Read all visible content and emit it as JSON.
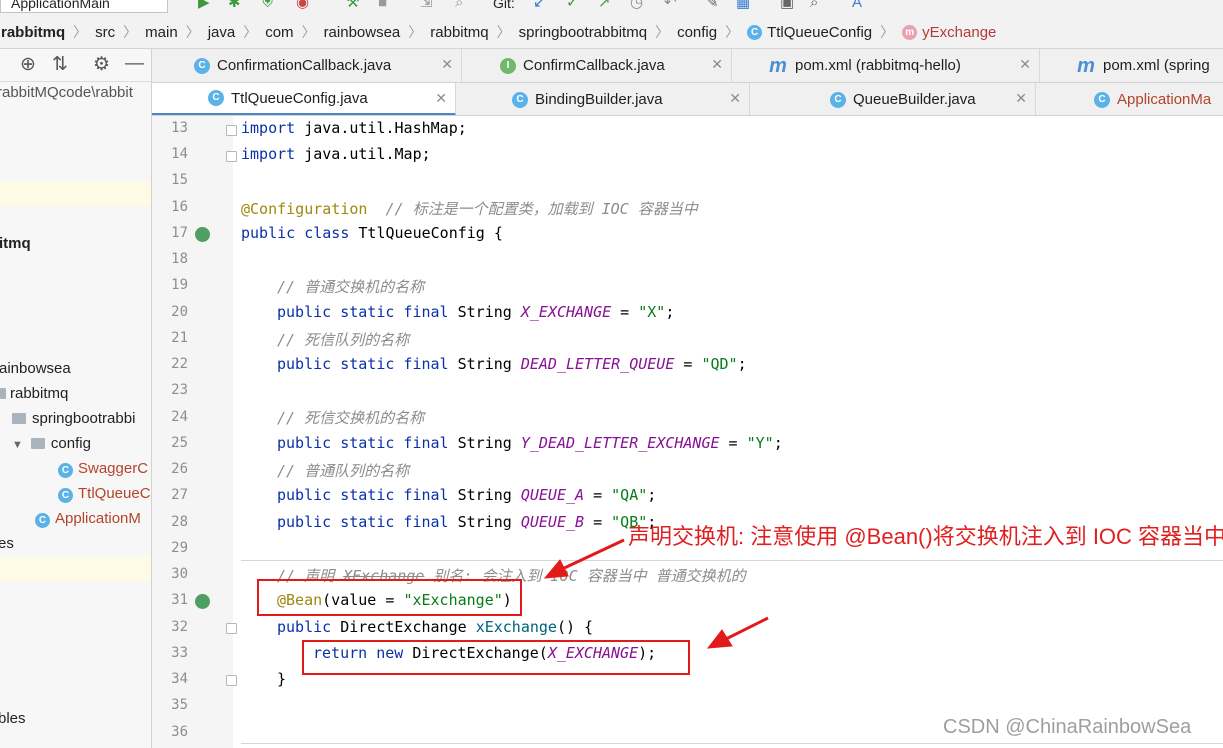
{
  "toolbar": {
    "run_config": "ApplicationMain",
    "git_label": "Git:"
  },
  "breadcrumb": [
    "rabbitmq",
    "src",
    "main",
    "java",
    "com",
    "rainbowsea",
    "rabbitmq",
    "springbootrabbitmq",
    "config",
    "TtlQueueConfig",
    "yExchange"
  ],
  "left_panel": {
    "path": "rabbitMQcode\\rabbit",
    "tree": [
      {
        "label": "itmq",
        "bold": true
      },
      {
        "label": "ainbowsea"
      },
      {
        "label": "rabbitmq"
      },
      {
        "label": "springbootrabbi"
      },
      {
        "label": "config"
      },
      {
        "label": "SwaggerC"
      },
      {
        "label": "TtlQueueC"
      },
      {
        "label": "ApplicationM"
      },
      {
        "label": "es"
      },
      {
        "label": "bles"
      }
    ]
  },
  "tabs_row1": [
    {
      "label": "ConfirmationCallback.java",
      "icon": "C"
    },
    {
      "label": "ConfirmCallback.java",
      "icon": "I"
    },
    {
      "label": "pom.xml (rabbitmq-hello)",
      "icon": "m"
    },
    {
      "label": "pom.xml (spring",
      "icon": "m"
    }
  ],
  "tabs_row2": [
    {
      "label": "TtlQueueConfig.java",
      "icon": "C",
      "active": true
    },
    {
      "label": "BindingBuilder.java",
      "icon": "C"
    },
    {
      "label": "QueueBuilder.java",
      "icon": "C"
    },
    {
      "label": "ApplicationMa",
      "icon": "C"
    }
  ],
  "line_numbers": [
    "13",
    "14",
    "15",
    "16",
    "17",
    "18",
    "19",
    "20",
    "21",
    "22",
    "23",
    "24",
    "25",
    "26",
    "27",
    "28",
    "29",
    "30",
    "31",
    "32",
    "33",
    "34",
    "35",
    "36"
  ],
  "code": {
    "l13_kw": "import",
    "l13_rest": " java.util.HashMap;",
    "l14_kw": "import",
    "l14_rest": " java.util.Map;",
    "l16_ann": "@Configuration",
    "l16_cm": "  // 标注是一个配置类，加载到 IOC 容器当中",
    "l17_kw": "public class",
    "l17_rest": " TtlQueueConfig {",
    "l19_cm": "// 普通交换机的名称",
    "mods": "public static final",
    "type": " String ",
    "l20_fld": "X_EXCHANGE",
    "l20_str": "\"X\"",
    "l21_cm": "// 死信队列的名称",
    "l22_fld": "DEAD_LETTER_QUEUE",
    "l22_str": "\"QD\"",
    "l24_cm": "// 死信交换机的名称",
    "l25_fld": "Y_DEAD_LETTER_EXCHANGE",
    "l25_str": "\"Y\"",
    "l26_cm": "// 普通队列的名称",
    "l27_fld": "QUEUE_A",
    "l27_str": "\"QA\"",
    "l28_fld": "QUEUE_B",
    "l28_str": "\"QB\"",
    "l30_cm_a": "// 声明 ",
    "l30_cm_b": "XExchange",
    "l30_cm_c": " 别名: 会注入到 IOC 容器当中 普通交换机的",
    "l31_ann": "@Bean",
    "l31_a": "(value = ",
    "l31_str": "\"xExchange\"",
    "l31_b": ")",
    "l32_kw": "public",
    "l32_a": " DirectExchange ",
    "l32_mth": "xExchange",
    "l32_b": "() {",
    "l33_kw": "return new",
    "l33_a": " DirectExchange(",
    "l33_fld": "X_EXCHANGE",
    "l33_b": ");",
    "l34": "}",
    "eq": " = ",
    "semi": ";"
  },
  "annotation_text": "声明交换机: 注意使用 @Bean()将交换机注入到 IOC 容器当中",
  "watermark": "CSDN @ChinaRainbowSea",
  "colors": {
    "keyword": "#0b31a8",
    "string": "#067d17",
    "comment": "#8c8c8c",
    "annotation": "#9e880d",
    "field": "#871094",
    "highlight_red": "#e21a1a",
    "tab_underline": "#4a86c8"
  }
}
